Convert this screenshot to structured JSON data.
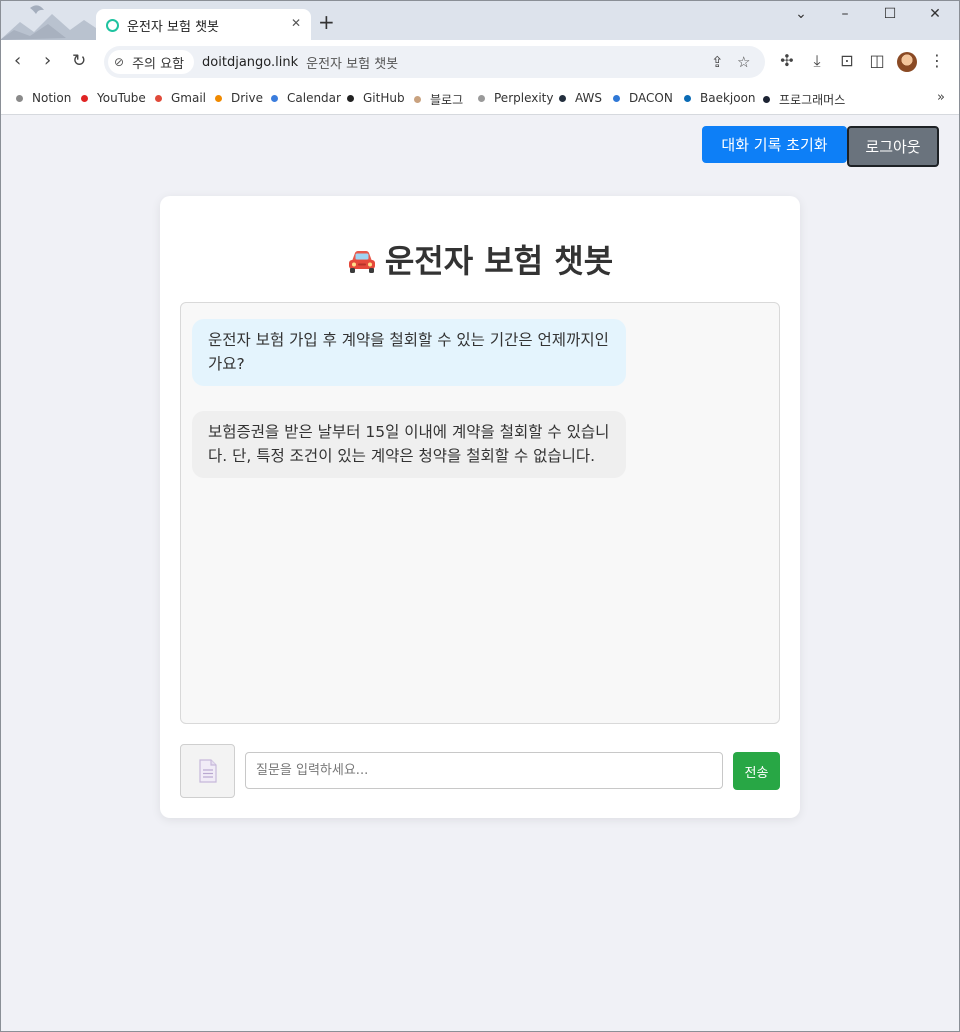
{
  "browser": {
    "tab_title": "운전자 보험 챗봇",
    "tab_close": "✕",
    "new_tab": "+",
    "security_label": "주의 요함",
    "url_domain": "doitdjango.link",
    "url_title": "운전자 보험 챗봇",
    "bookmarks": [
      {
        "label": "Notion",
        "color": "#8a8a8a"
      },
      {
        "label": "YouTube",
        "color": "#e02424"
      },
      {
        "label": "Gmail",
        "color": "#e04a3a"
      },
      {
        "label": "Drive",
        "color": "#f08a00"
      },
      {
        "label": "Calendar",
        "color": "#3b7ddd"
      },
      {
        "label": "GitHub",
        "color": "#222222"
      },
      {
        "label": "블로그",
        "color": "#c9a27f"
      },
      {
        "label": "Perplexity",
        "color": "#9a9a9a"
      },
      {
        "label": "AWS",
        "color": "#232f3e"
      },
      {
        "label": "DACON",
        "color": "#2f78d6"
      },
      {
        "label": "Baekjoon",
        "color": "#0a6bb5"
      },
      {
        "label": "프로그래머스",
        "color": "#1c2333"
      }
    ],
    "bookmarks_more": "»"
  },
  "header": {
    "reset_label": "대화 기록 초기화",
    "logout_label": "로그아웃"
  },
  "chat": {
    "title": "운전자 보험 챗봇",
    "messages": [
      {
        "role": "user",
        "text": "운전자 보험 가입 후 계약을 철회할 수 있는 기간은 언제까지인가요?"
      },
      {
        "role": "bot",
        "text": "보험증권을 받은 날부터 15일 이내에 계약을 철회할 수 있습니다. 단, 특정 조건이 있는 계약은 청약을 철회할 수 없습니다."
      }
    ],
    "input_placeholder": "질문을 입력하세요...",
    "send_label": "전송"
  },
  "colors": {
    "primary": "#0d7ff7",
    "secondary": "#6a737d",
    "success": "#28a745",
    "user_bubble": "#e4f4fd",
    "bot_bubble": "#efefef"
  },
  "icons": [
    "car-icon",
    "document-icon",
    "back-icon",
    "forward-icon",
    "reload-icon",
    "share-icon",
    "bookmark-star-icon",
    "extensions-icon",
    "download-icon",
    "screenshot-icon",
    "sidebar-icon",
    "menu-icon"
  ]
}
